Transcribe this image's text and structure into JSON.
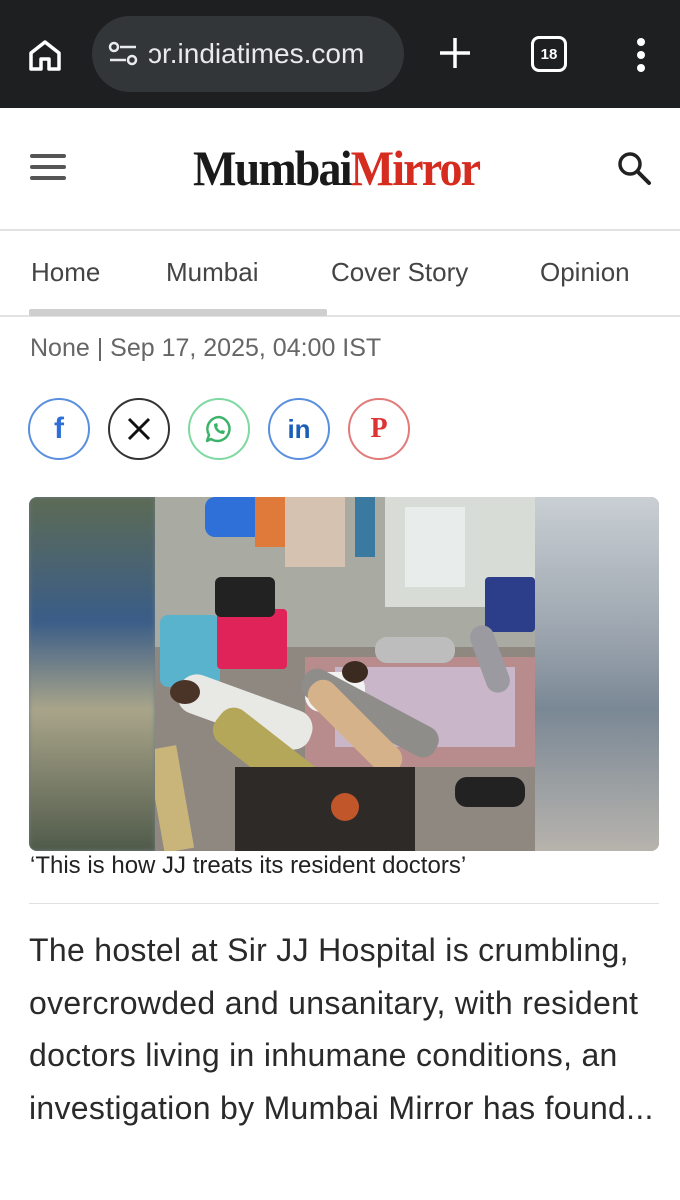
{
  "browser": {
    "url_text": "ɔr.indiatimes.com",
    "tab_count": "18",
    "icons": {
      "home": "home-icon",
      "site_settings": "tune-icon",
      "new_tab": "plus-icon",
      "tabs": "tab-switcher-icon",
      "menu": "more-vert-icon"
    }
  },
  "header": {
    "logo_part1": "Mumbai",
    "logo_part2": "Mirror",
    "colors": {
      "logo_dark": "#1a1a1a",
      "logo_red": "#d62b1f"
    },
    "icons": {
      "menu": "hamburger-icon",
      "search": "search-icon"
    }
  },
  "nav": {
    "tabs": [
      {
        "label": "Home"
      },
      {
        "label": "Mumbai"
      },
      {
        "label": "Cover Story"
      },
      {
        "label": "Opinion"
      }
    ]
  },
  "article": {
    "meta": "None | Sep 17, 2025, 04:00 IST",
    "share": {
      "facebook": "f",
      "x": "𝕏",
      "whatsapp": "whatsapp-icon",
      "linkedin": "in",
      "pinterest": "P"
    },
    "image_caption": "‘This is how JJ treats its resident doctors’",
    "body": "The hostel at Sir JJ Hospital is crumbling, overcrowded and unsanitary, with resident doctors living in inhumane conditions, an investigation by Mumbai Mirror has found..."
  }
}
